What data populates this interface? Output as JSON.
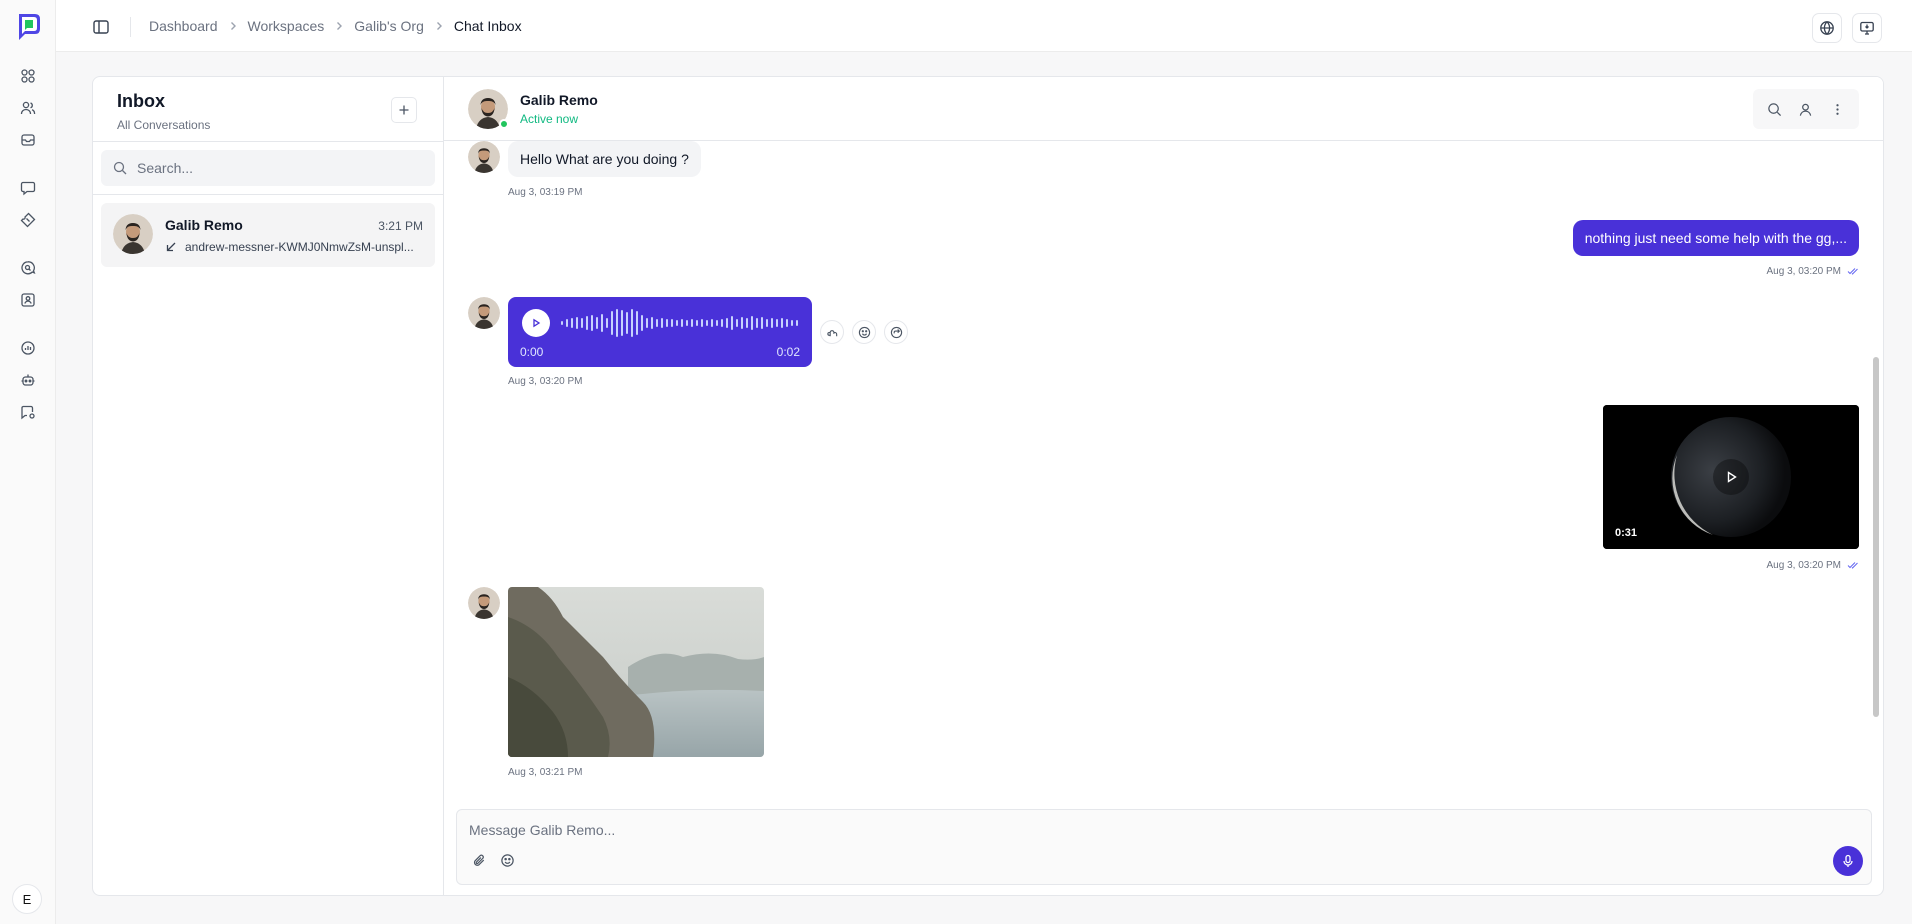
{
  "rail": {
    "user_initial": "E"
  },
  "breadcrumbs": [
    "Dashboard",
    "Workspaces",
    "Galib's Org",
    "Chat Inbox"
  ],
  "inbox": {
    "title": "Inbox",
    "subtitle": "All Conversations",
    "search_placeholder": "Search...",
    "conversations": [
      {
        "name": "Galib Remo",
        "time": "3:21 PM",
        "preview": "andrew-messner-KWMJ0NmwZsM-unspl..."
      }
    ]
  },
  "chat": {
    "contact_name": "Galib Remo",
    "status": "Active now",
    "messages": [
      {
        "direction": "in",
        "type": "text",
        "text": "Hello What are you doing ?",
        "time": "Aug 3, 03:19 PM"
      },
      {
        "direction": "out",
        "type": "text",
        "text": "nothing just need some help with the gg,...",
        "time": "Aug 3, 03:20 PM"
      },
      {
        "direction": "in",
        "type": "voice",
        "elapsed": "0:00",
        "duration": "0:02",
        "time": "Aug 3, 03:20 PM"
      },
      {
        "direction": "out",
        "type": "video",
        "duration": "0:31",
        "time": "Aug 3, 03:20 PM"
      },
      {
        "direction": "in",
        "type": "image",
        "time": "Aug 3, 03:21 PM"
      }
    ]
  },
  "composer": {
    "placeholder": "Message Galib Remo..."
  },
  "colors": {
    "accent": "#4931d8",
    "online": "#22c55e",
    "status_text": "#10b981"
  }
}
